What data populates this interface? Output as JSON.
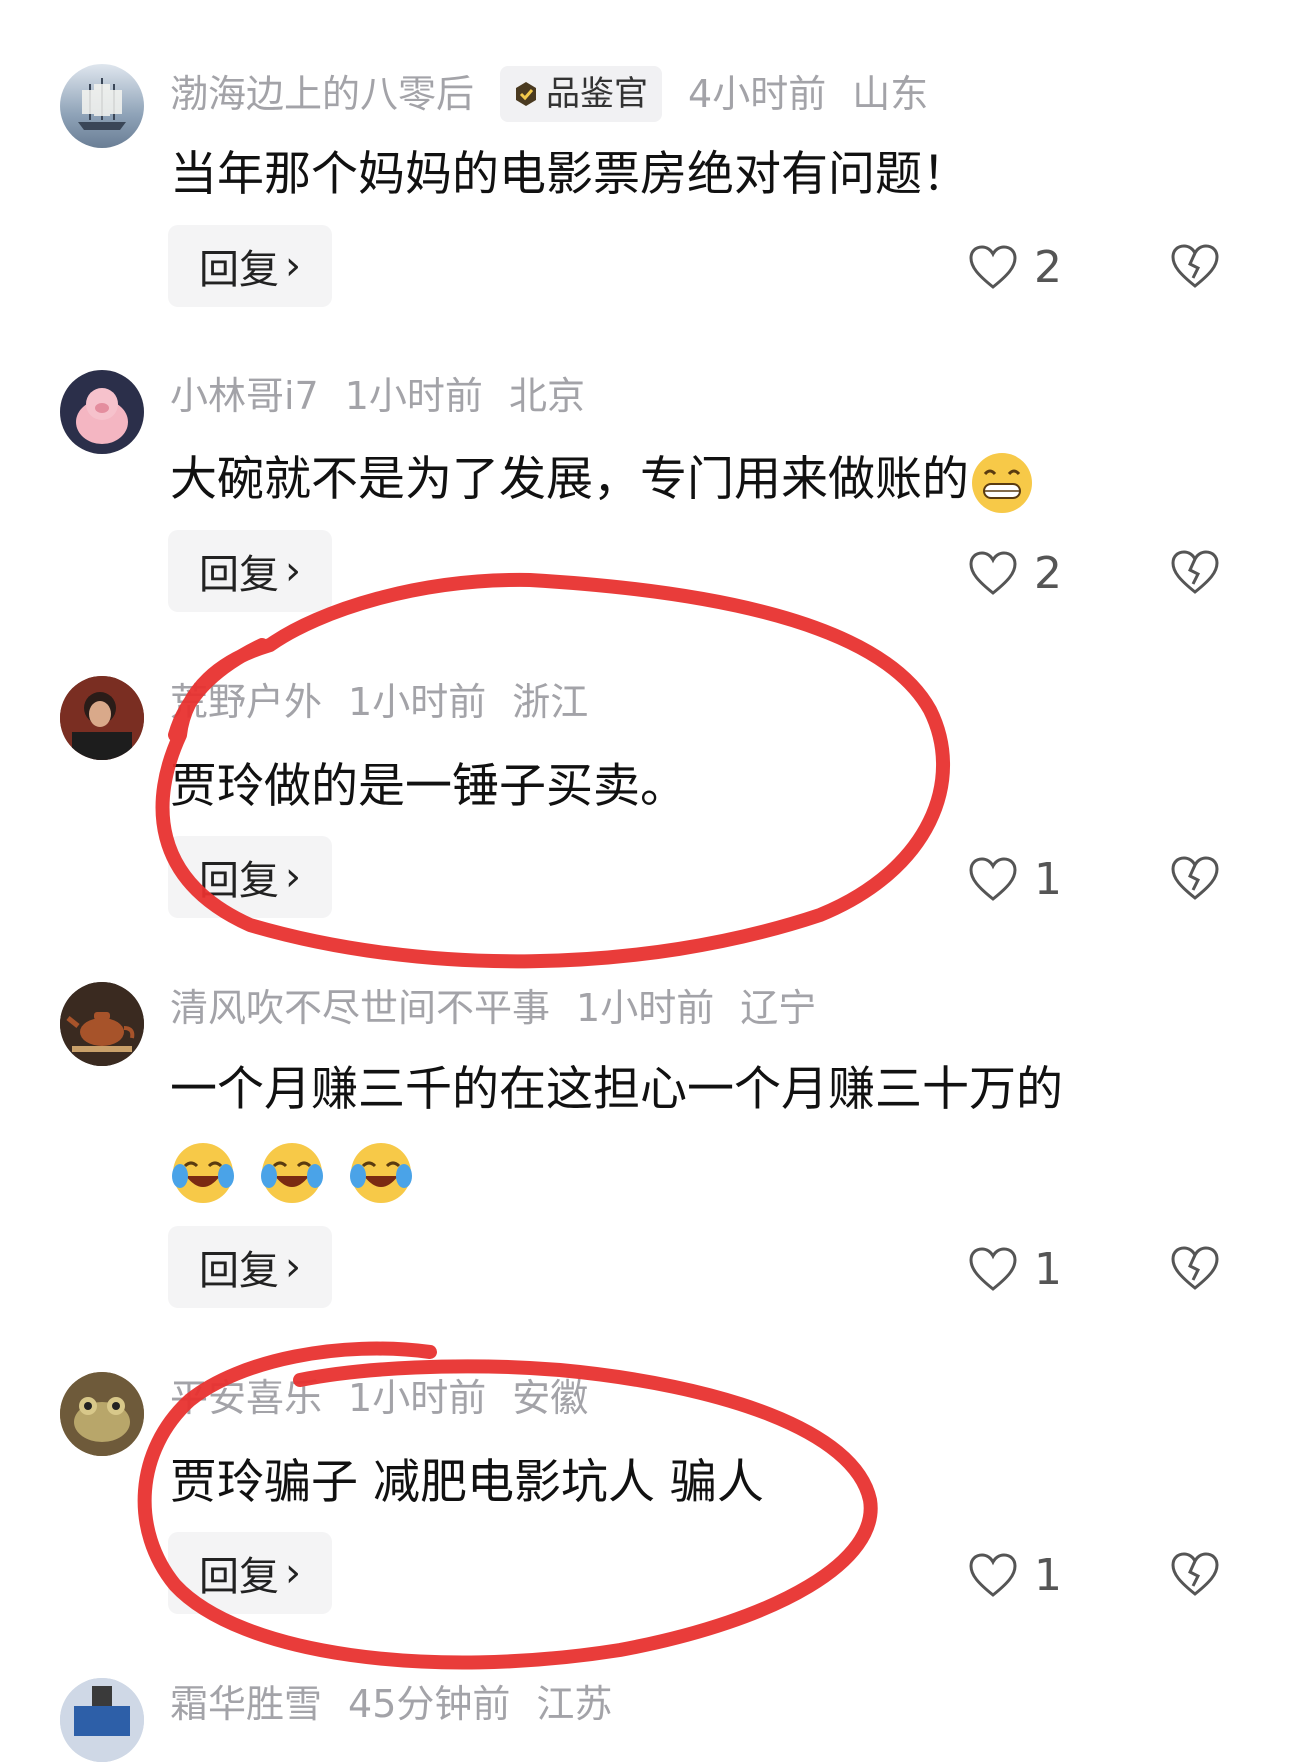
{
  "reply_label": "回复",
  "comments": [
    {
      "user": "渤海边上的八零后",
      "badge": "品鉴官",
      "time": "4小时前",
      "location": "山东",
      "text": "当年那个妈妈的电影票房绝对有问题！",
      "likes": "2"
    },
    {
      "user": "小林哥i7",
      "time": "1小时前",
      "location": "北京",
      "text": "大碗就不是为了发展，专门用来做账的",
      "emoji": "grin-emoji",
      "likes": "2"
    },
    {
      "user": "荒野户外",
      "time": "1小时前",
      "location": "浙江",
      "text": "贾玲做的是一锤子买卖。",
      "likes": "1"
    },
    {
      "user": "清风吹不尽世间不平事",
      "time": "1小时前",
      "location": "辽宁",
      "text": "一个月赚三千的在这担心一个月赚三十万的",
      "emoji": "laugh-cry-emoji",
      "likes": "1"
    },
    {
      "user": "平安喜乐",
      "time": "1小时前",
      "location": "安徽",
      "text": "贾玲骗子 减肥电影坑人 骗人",
      "likes": "1"
    },
    {
      "user": "霜华胜雪",
      "time": "45分钟前",
      "location": "江苏"
    }
  ],
  "annotation_color": "#e8322f"
}
